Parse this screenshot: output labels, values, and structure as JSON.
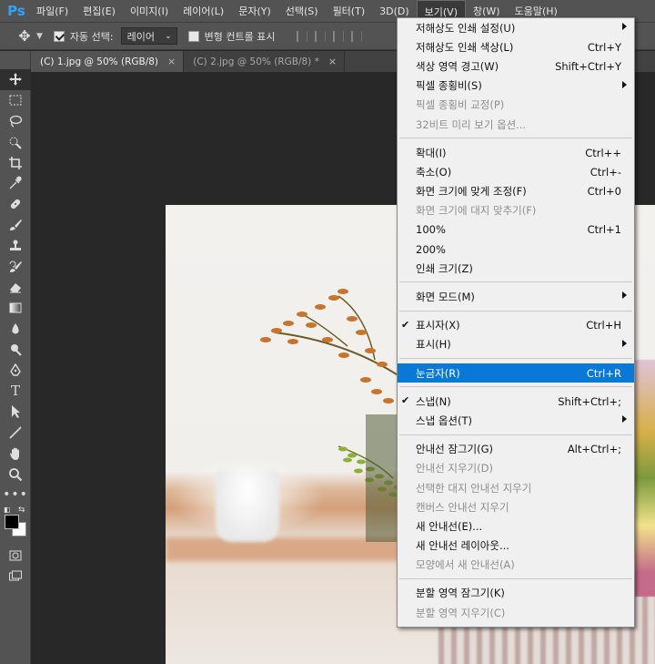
{
  "app": {
    "logo": "Ps",
    "menu_bar": [
      "파일(F)",
      "편집(E)",
      "이미지(I)",
      "레이어(L)",
      "문자(Y)",
      "선택(S)",
      "필터(T)",
      "3D(D)",
      "보기(V)",
      "창(W)",
      "도움말(H)"
    ],
    "active_menu": "보기(V)"
  },
  "options_bar": {
    "auto_select_label": "자동 선택:",
    "auto_select_checked": true,
    "auto_select_value": "레이어",
    "transform_controls_label": "변형 컨트롤 표시",
    "transform_controls_checked": false
  },
  "tabs": [
    {
      "label": "(C) 1.jpg @ 50% (RGB/8)",
      "active": true
    },
    {
      "label": "(C) 2.jpg @ 50% (RGB/8) *",
      "active": false
    }
  ],
  "tools": [
    "move-icon",
    "marquee-icon",
    "lasso-icon",
    "quick-select-icon",
    "crop-icon",
    "eyedropper-icon",
    "healing-icon",
    "brush-icon",
    "stamp-icon",
    "history-brush-icon",
    "eraser-icon",
    "gradient-icon",
    "blur-icon",
    "dodge-icon",
    "pen-icon",
    "type-icon",
    "path-select-icon",
    "line-icon",
    "hand-icon",
    "zoom-icon",
    "more-icon"
  ],
  "view_menu": {
    "items": [
      {
        "type": "item",
        "label": "저해상도 인쇄 설정(U)",
        "shortcut": "",
        "disabled": false,
        "submenu": true
      },
      {
        "type": "item",
        "label": "저해상도 인쇄 색상(L)",
        "shortcut": "Ctrl+Y",
        "disabled": false
      },
      {
        "type": "item",
        "label": "색상 영역 경고(W)",
        "shortcut": "Shift+Ctrl+Y",
        "disabled": false
      },
      {
        "type": "item",
        "label": "픽셀 종횡비(S)",
        "shortcut": "",
        "disabled": false,
        "submenu": true
      },
      {
        "type": "item",
        "label": "픽셀 종횡비 교정(P)",
        "shortcut": "",
        "disabled": true
      },
      {
        "type": "item",
        "label": "32비트 미리 보기 옵션...",
        "shortcut": "",
        "disabled": true
      },
      {
        "type": "sep"
      },
      {
        "type": "item",
        "label": "확대(I)",
        "shortcut": "Ctrl++",
        "disabled": false
      },
      {
        "type": "item",
        "label": "축소(O)",
        "shortcut": "Ctrl+-",
        "disabled": false
      },
      {
        "type": "item",
        "label": "화면 크기에 맞게 조정(F)",
        "shortcut": "Ctrl+0",
        "disabled": false
      },
      {
        "type": "item",
        "label": "화면 크기에 대지 맞추기(F)",
        "shortcut": "",
        "disabled": true
      },
      {
        "type": "item",
        "label": "100%",
        "shortcut": "Ctrl+1",
        "disabled": false
      },
      {
        "type": "item",
        "label": "200%",
        "shortcut": "",
        "disabled": false
      },
      {
        "type": "item",
        "label": "인쇄 크기(Z)",
        "shortcut": "",
        "disabled": false
      },
      {
        "type": "sep"
      },
      {
        "type": "item",
        "label": "화면 모드(M)",
        "shortcut": "",
        "disabled": false,
        "submenu": true
      },
      {
        "type": "sep"
      },
      {
        "type": "item",
        "label": "표시자(X)",
        "shortcut": "Ctrl+H",
        "disabled": false,
        "checked": true
      },
      {
        "type": "item",
        "label": "표시(H)",
        "shortcut": "",
        "disabled": false,
        "submenu": true
      },
      {
        "type": "sep"
      },
      {
        "type": "item",
        "label": "눈금자(R)",
        "shortcut": "Ctrl+R",
        "disabled": false,
        "highlighted": true
      },
      {
        "type": "sep"
      },
      {
        "type": "item",
        "label": "스냅(N)",
        "shortcut": "Shift+Ctrl+;",
        "disabled": false,
        "checked": true
      },
      {
        "type": "item",
        "label": "스냅 옵션(T)",
        "shortcut": "",
        "disabled": false,
        "submenu": true
      },
      {
        "type": "sep"
      },
      {
        "type": "item",
        "label": "안내선 잠그기(G)",
        "shortcut": "Alt+Ctrl+;",
        "disabled": false
      },
      {
        "type": "item",
        "label": "안내선 지우기(D)",
        "shortcut": "",
        "disabled": true
      },
      {
        "type": "item",
        "label": "선택한 대지 안내선 지우기",
        "shortcut": "",
        "disabled": true
      },
      {
        "type": "item",
        "label": "캔버스 안내선 지우기",
        "shortcut": "",
        "disabled": true
      },
      {
        "type": "item",
        "label": "새 안내선(E)...",
        "shortcut": "",
        "disabled": false
      },
      {
        "type": "item",
        "label": "새 안내선 레이아웃...",
        "shortcut": "",
        "disabled": false
      },
      {
        "type": "item",
        "label": "모양에서 새 안내선(A)",
        "shortcut": "",
        "disabled": true
      },
      {
        "type": "sep"
      },
      {
        "type": "item",
        "label": "분할 영역 잠그기(K)",
        "shortcut": "",
        "disabled": false
      },
      {
        "type": "item",
        "label": "분할 영역 지우기(C)",
        "shortcut": "",
        "disabled": true
      }
    ]
  },
  "colors": {
    "accent": "#0a78d7",
    "ps_blue": "#2fa3f7",
    "ui_gray": "#535353",
    "foreground": "#000000",
    "background": "#ffffff"
  }
}
